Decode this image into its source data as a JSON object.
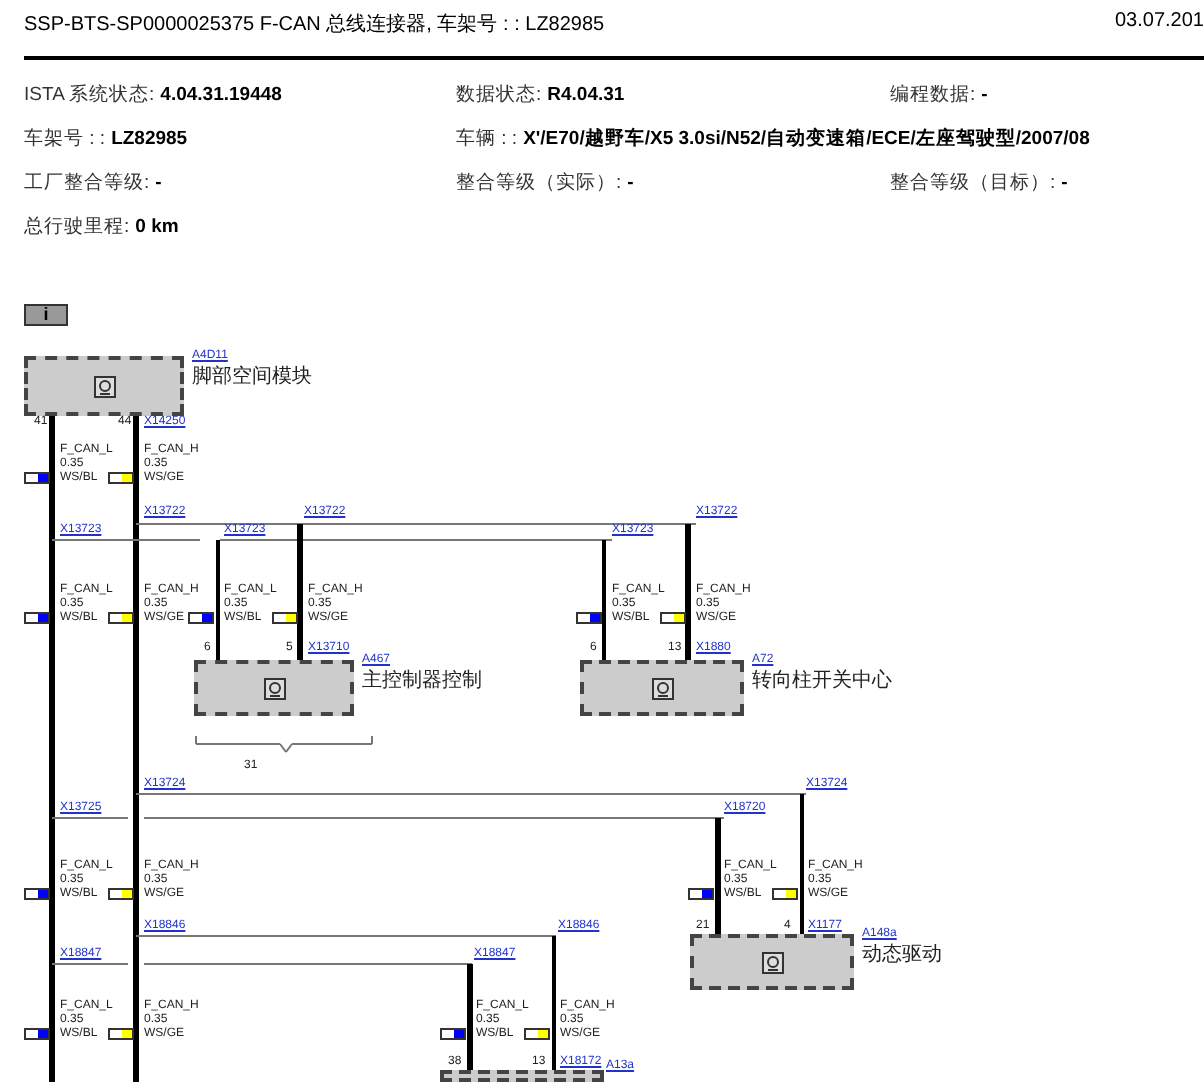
{
  "header": {
    "title": "SSP-BTS-SP0000025375 F-CAN 总线连接器, 车架号 : : LZ82985",
    "date": "03.07.201"
  },
  "info_rows": [
    [
      {
        "label": "ISTA 系统状态:",
        "value": "4.04.31.19448"
      },
      {
        "label": "数据状态:",
        "value": "R4.04.31"
      },
      {
        "label": "编程数据:",
        "value": "-"
      }
    ],
    [
      {
        "label": "车架号 : :",
        "value": "LZ82985"
      },
      {
        "label": "车辆 : :",
        "value": "X'/E70/越野车/X5 3.0si/N52/自动变速箱/ECE/左座驾驶型/2007/08"
      }
    ],
    [
      {
        "label": "工厂整合等级:",
        "value": "-"
      },
      {
        "label": "整合等级（实际）:",
        "value": "-"
      },
      {
        "label": "整合等级（目标）:",
        "value": "-"
      }
    ],
    [
      {
        "label": "总行驶里程:",
        "value": "0 km"
      }
    ]
  ],
  "info_button": "i",
  "components": [
    {
      "label": "A4D11",
      "description": "脚部空间模块"
    },
    {
      "label": "A467",
      "description": "主控制器控制"
    },
    {
      "label": "A72",
      "description": "转向柱开关中心"
    },
    {
      "label": "A148a",
      "description": "动态驱动"
    },
    {
      "label": "A13a"
    }
  ],
  "connectors": [
    "X14250",
    "X13722",
    "X13722",
    "X13722",
    "X13723",
    "X13723",
    "X13723",
    "X13710",
    "X1880",
    "X13724",
    "X13724",
    "X13725",
    "X18720",
    "X18846",
    "X18846",
    "X1177",
    "X18847",
    "X18847",
    "X18172"
  ],
  "pins": [
    "41",
    "44",
    "6",
    "5",
    "6",
    "13",
    "21",
    "4",
    "38",
    "13"
  ],
  "wires": [
    {
      "signal": "F_CAN_L",
      "size": "0.35",
      "color_code": "WS/BL",
      "color": "#0000ff"
    },
    {
      "signal": "F_CAN_H",
      "size": "0.35",
      "color_code": "WS/GE",
      "color": "#ffff00"
    },
    {
      "signal": "F_CAN_L",
      "size": "0.35",
      "color_code": "WS/BL",
      "color": "#0000ff"
    },
    {
      "signal": "F_CAN_H",
      "size": "0.35",
      "color_code": "WS/GE",
      "color": "#ffff00"
    },
    {
      "signal": "F_CAN_L",
      "size": "0.35",
      "color_code": "WS/BL",
      "color": "#0000ff"
    },
    {
      "signal": "F_CAN_H",
      "size": "0.35",
      "color_code": "WS/GE",
      "color": "#ffff00"
    },
    {
      "signal": "F_CAN_L",
      "size": "0.35",
      "color_code": "WS/BL",
      "color": "#0000ff"
    },
    {
      "signal": "F_CAN_H",
      "size": "0.35",
      "color_code": "WS/GE",
      "color": "#ffff00"
    },
    {
      "signal": "F_CAN_L",
      "size": "0.35",
      "color_code": "WS/BL",
      "color": "#0000ff"
    },
    {
      "signal": "F_CAN_H",
      "size": "0.35",
      "color_code": "WS/GE",
      "color": "#ffff00"
    },
    {
      "signal": "F_CAN_L",
      "size": "0.35",
      "color_code": "WS/BL",
      "color": "#0000ff"
    },
    {
      "signal": "F_CAN_H",
      "size": "0.35",
      "color_code": "WS/GE",
      "color": "#ffff00"
    },
    {
      "signal": "F_CAN_L",
      "size": "0.35",
      "color_code": "WS/BL",
      "color": "#0000ff"
    },
    {
      "signal": "F_CAN_H",
      "size": "0.35",
      "color_code": "WS/GE",
      "color": "#ffff00"
    },
    {
      "signal": "F_CAN_L",
      "size": "0.35",
      "color_code": "WS/BL",
      "color": "#0000ff"
    },
    {
      "signal": "F_CAN_H",
      "size": "0.35",
      "color_code": "WS/GE",
      "color": "#ffff00"
    }
  ],
  "brace_label": "31"
}
